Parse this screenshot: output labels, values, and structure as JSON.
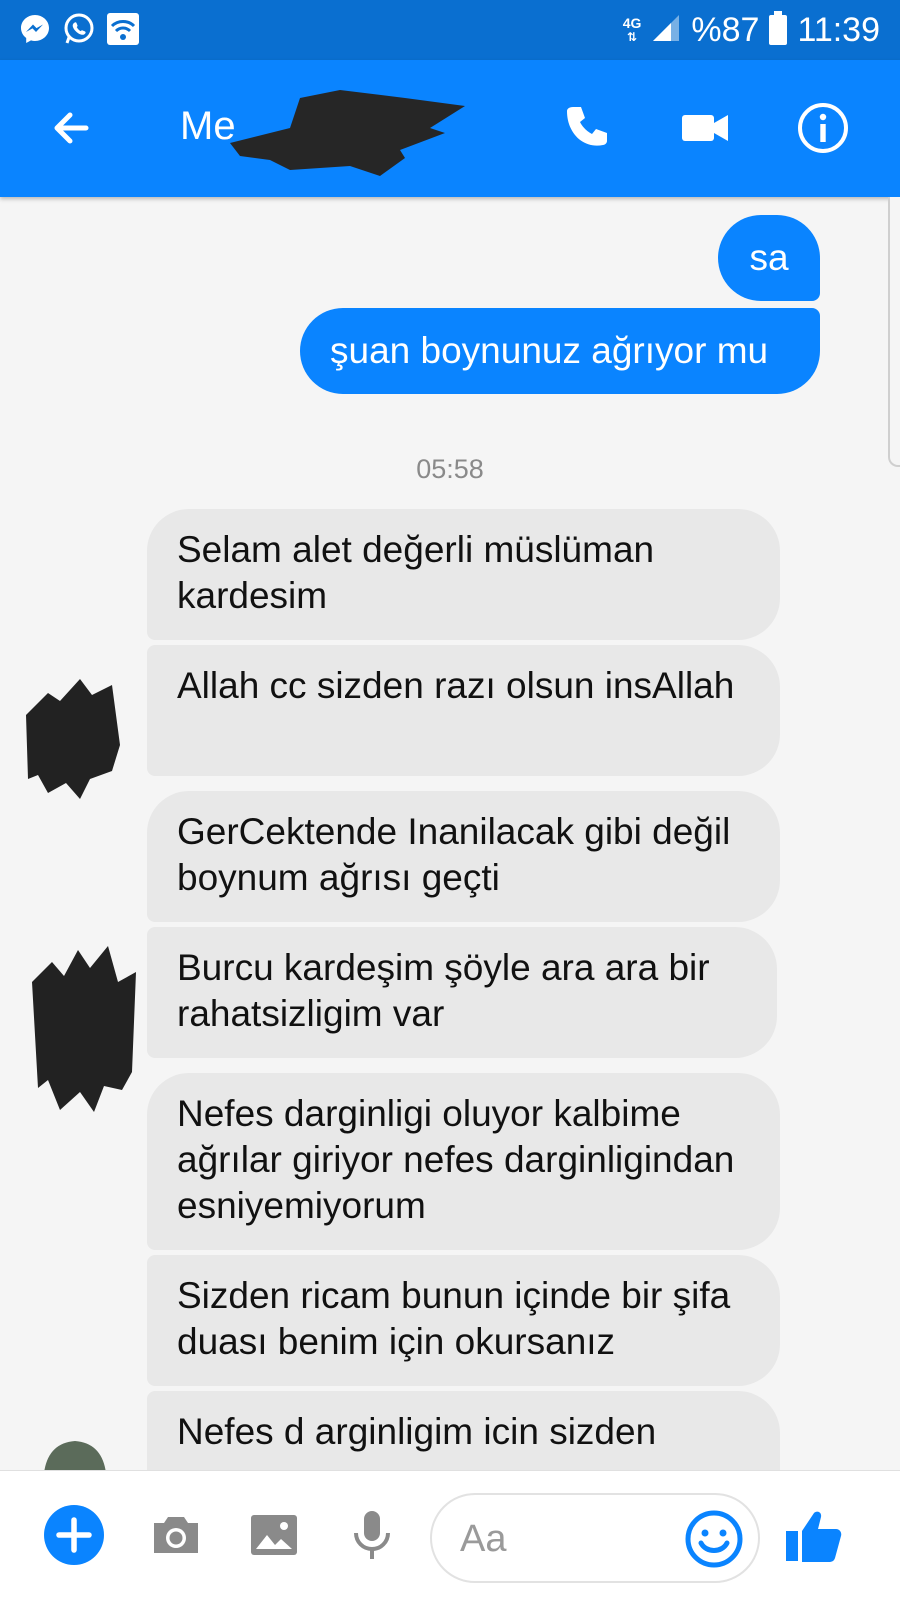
{
  "status_bar": {
    "network": "4G",
    "battery": "%87",
    "time": "11:39",
    "left_icons": [
      "messenger-icon",
      "whatsapp-icon",
      "wifi-icon"
    ]
  },
  "header": {
    "title": "Me"
  },
  "messages": {
    "outgoing": [
      {
        "text": "sa"
      },
      {
        "text": "şuan boynunuz ağrıyor mu"
      }
    ],
    "timestamp": "05:58",
    "incoming": [
      {
        "text": "Selam alet değerli müslüman kardesim"
      },
      {
        "text": "Allah cc sizden razı olsun insAllah"
      },
      {
        "text": "GerCektende Inanilacak gibi değil boynum ağrısı geçti"
      },
      {
        "text": "Burcu kardeşim şöyle  ara ara bir rahatsizligim var"
      },
      {
        "text": "Nefes darginligi oluyor kalbime ağrılar giriyor nefes darginligindan esniyemiyorum"
      },
      {
        "text": "Sizden ricam bunun içinde bir şifa duası benim için okursanız"
      },
      {
        "text": "Nefes d arginligim icin sizden"
      }
    ]
  },
  "composer": {
    "placeholder": "Aa"
  },
  "colors": {
    "status_bar": "#0a6fd0",
    "header": "#0a84ff",
    "outgoing_bubble": "#0a84ff",
    "incoming_bubble": "#e8e8e8"
  }
}
